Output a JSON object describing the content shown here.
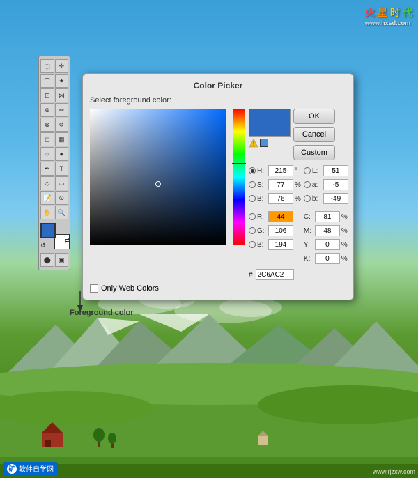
{
  "background": {
    "sky_gradient_start": "#3a9fd8",
    "sky_gradient_end": "#5bb8e8"
  },
  "dialog": {
    "title": "Color Picker",
    "header": "Select foreground color:",
    "buttons": {
      "ok": "OK",
      "cancel": "Cancel",
      "custom": "Custom"
    },
    "fields": {
      "h_label": "H:",
      "h_value": "215",
      "h_unit": "°",
      "s_label": "S:",
      "s_value": "77",
      "s_unit": "%",
      "b_label": "B:",
      "b_value": "76",
      "b_unit": "%",
      "r_label": "R:",
      "r_value": "44",
      "g_label": "G:",
      "g_value": "106",
      "blue_label": "B:",
      "blue_value": "194",
      "l_label": "L:",
      "l_value": "51",
      "a_label": "a:",
      "a_value": "-5",
      "b2_label": "b:",
      "b2_value": "-49",
      "c_label": "C:",
      "c_value": "81",
      "c_unit": "%",
      "m_label": "M:",
      "m_value": "48",
      "m_unit": "%",
      "y_label": "Y:",
      "y_value": "0",
      "y_unit": "%",
      "k_label": "K:",
      "k_value": "0",
      "k_unit": "%"
    },
    "hex_label": "#",
    "hex_value": "2C6AC2",
    "checkbox_label": "Only Web Colors"
  },
  "toolbar": {
    "tools": [
      "marquee",
      "lasso",
      "crop",
      "heal",
      "brush",
      "stamp",
      "eraser",
      "gradient",
      "dodge",
      "pen",
      "text",
      "path",
      "shape",
      "notes",
      "eyedropper",
      "hand",
      "zoom"
    ]
  },
  "annotation": {
    "text": "Foreground color"
  },
  "watermark": {
    "top": "火星时代",
    "top_sub": "www.hxsd.com",
    "bottom_left": "软件自学网",
    "bottom_right": "www.rjzxw.com"
  }
}
